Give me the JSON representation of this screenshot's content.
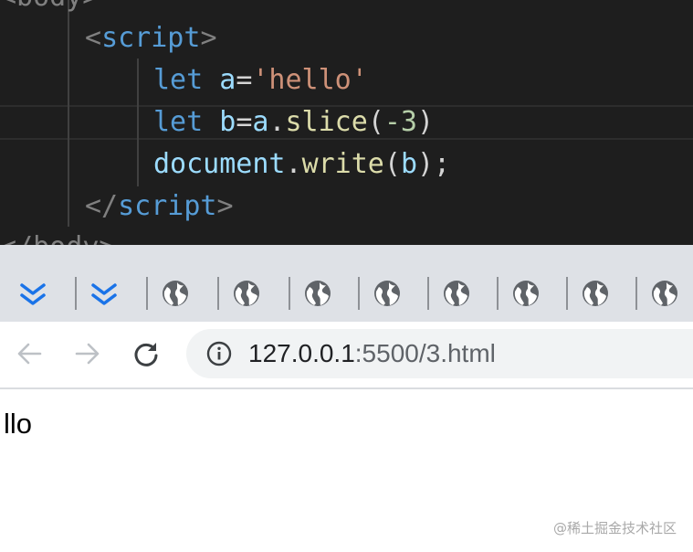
{
  "editor": {
    "top_partial": "<body>",
    "bottom_partial": "</body>",
    "script_open": {
      "lt": "<",
      "tag": "script",
      "gt": ">"
    },
    "line1": {
      "kw": "let",
      "var": "a",
      "eq": "=",
      "str": "'hello'"
    },
    "line2": {
      "kw": "let",
      "var": "b",
      "eq": "=",
      "obj": "a",
      "dot": ".",
      "fn": "slice",
      "open": "(",
      "num": "-3",
      "close": ")"
    },
    "line3": {
      "obj": "document",
      "dot": ".",
      "fn": "write",
      "open": "(",
      "arg": "b",
      "close": ");"
    },
    "script_close": {
      "lt": "</",
      "tag": "script",
      "gt": ">"
    }
  },
  "bookmarks": {
    "icons": [
      "bookmark-chevron-icon",
      "bookmark-chevron-icon",
      "globe-icon",
      "globe-icon",
      "globe-icon",
      "globe-icon",
      "globe-icon",
      "globe-icon",
      "globe-icon",
      "globe-icon"
    ]
  },
  "toolbar": {
    "back_icon": "arrow-left-icon",
    "forward_icon": "arrow-right-icon",
    "reload_icon": "reload-icon",
    "site_info_icon": "info-icon",
    "url_host": "127.0.0.1",
    "url_rest": ":5500/3.html"
  },
  "page": {
    "output_text": "llo"
  },
  "watermark": "@稀土掘金技术社区",
  "colors": {
    "editor_bg": "#1e1e1e",
    "keyword": "#569cd6",
    "variable": "#9cdcfe",
    "string": "#ce9178",
    "function": "#dcdcaa",
    "number": "#b5cea8",
    "bookmark_bar_bg": "#dee1e6",
    "bookmark_accent": "#1a73e8",
    "omnibox_bg": "#f1f3f4"
  }
}
